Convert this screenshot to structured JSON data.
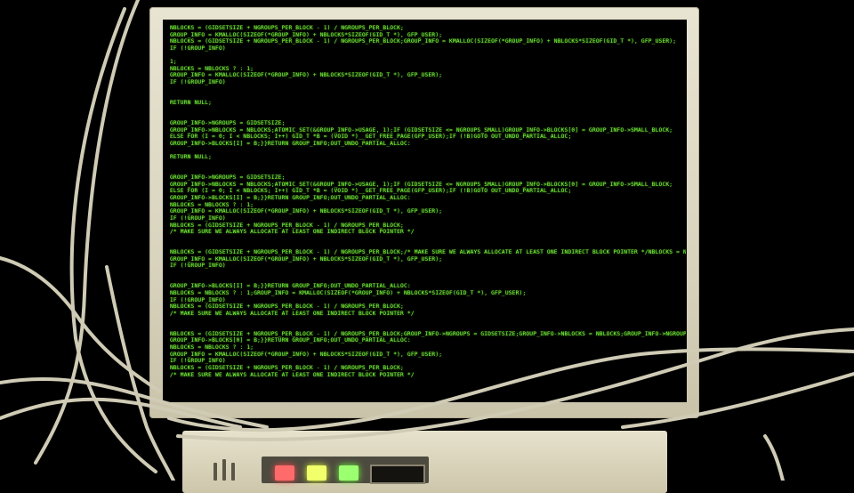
{
  "scene": {
    "description_free": true,
    "colors": {
      "background": "#000000",
      "bezel": "#e0dcc7",
      "terminal_text": "#7cff3a",
      "cable": "#cfcbb5",
      "led_red": "#ff6a6a",
      "led_yellow": "#f1ff6a",
      "led_green": "#9bff70"
    }
  },
  "terminal": {
    "lines": [
      "NBLOCKS = (GIDSETSIZE + NGROUPS_PER_BLOCK - 1) / NGROUPS_PER_BLOCK;",
      "GROUP_INFO = KMALLOC(SIZEOF(*GROUP_INFO) + NBLOCKS*SIZEOF(GID_T *), GFP_USER);",
      "NBLOCKS = (GIDSETSIZE + NGROUPS_PER_BLOCK - 1) / NGROUPS_PER_BLOCK;GROUP_INFO = KMALLOC(SIZEOF(*GROUP_INFO) + NBLOCKS*SIZEOF(GID_T *), GFP_USER);",
      "IF (!GROUP_INFO)",
      "",
      "1;",
      "NBLOCKS = NBLOCKS ? : 1;",
      "GROUP_INFO = KMALLOC(SIZEOF(*GROUP_INFO) + NBLOCKS*SIZEOF(GID_T *), GFP_USER);",
      "IF (!GROUP_INFO)",
      "",
      "",
      "RETURN NULL;",
      "",
      "",
      "GROUP_INFO->NGROUPS = GIDSETSIZE;",
      "GROUP_INFO->NBLOCKS = NBLOCKS;ATOMIC_SET(&GROUP_INFO->USAGE, 1);IF (GIDSETSIZE <= NGROUPS_SMALL)GROUP_INFO->BLOCKS[0] = GROUP_INFO->SMALL_BLOCK;",
      "ELSE FOR (I = 0; I < NBLOCKS; I++) GID_T *B = (VOID *)__GET_FREE_PAGE(GFP_USER);IF (!B)GOTO OUT_UNDO_PARTIAL_ALLOC;",
      "GROUP_INFO->BLOCKS[I] = B;}}RETURN GROUP_INFO;OUT_UNDO_PARTIAL_ALLOC:",
      "",
      "RETURN NULL;",
      "",
      "",
      "GROUP_INFO->NGROUPS = GIDSETSIZE;",
      "GROUP_INFO->NBLOCKS = NBLOCKS;ATOMIC_SET(&GROUP_INFO->USAGE, 1);IF (GIDSETSIZE <= NGROUPS_SMALL)GROUP_INFO->BLOCKS[0] = GROUP_INFO->SMALL_BLOCK;",
      "ELSE FOR (I = 0; I < NBLOCKS; I++) GID_T *B = (VOID *)__GET_FREE_PAGE(GFP_USER);IF (!B)GOTO OUT_UNDO_PARTIAL_ALLOC;",
      "GROUP_INFO->BLOCKS[I] = B;}}RETURN GROUP_INFO;OUT_UNDO_PARTIAL_ALLOC:",
      "NBLOCKS = NBLOCKS ? : 1;",
      "GROUP_INFO = KMALLOC(SIZEOF(*GROUP_INFO) + NBLOCKS*SIZEOF(GID_T *), GFP_USER);",
      "IF (!GROUP_INFO)",
      "NBLOCKS = (GIDSETSIZE + NGROUPS_PER_BLOCK - 1) / NGROUPS_PER_BLOCK;",
      "/* MAKE SURE WE ALWAYS ALLOCATE AT LEAST ONE INDIRECT BLOCK POINTER */",
      "",
      "",
      "NBLOCKS = (GIDSETSIZE + NGROUPS_PER_BLOCK - 1) / NGROUPS_PER_BLOCK;/* MAKE SURE WE ALWAYS ALLOCATE AT LEAST ONE INDIRECT BLOCK POINTER */NBLOCKS = NBLOCKS ? : 1;",
      "GROUP_INFO = KMALLOC(SIZEOF(*GROUP_INFO) + NBLOCKS*SIZEOF(GID_T *), GFP_USER);",
      "IF (!GROUP_INFO)",
      "",
      "",
      "GROUP_INFO->BLOCKS[I] = B;}}RETURN GROUP_INFO;OUT_UNDO_PARTIAL_ALLOC:",
      "NBLOCKS = NBLOCKS ? : 1;GROUP_INFO = KMALLOC(SIZEOF(*GROUP_INFO) + NBLOCKS*SIZEOF(GID_T *), GFP_USER);",
      "IF (!GROUP_INFO)",
      "NBLOCKS = (GIDSETSIZE + NGROUPS_PER_BLOCK - 1) / NGROUPS_PER_BLOCK;",
      "/* MAKE SURE WE ALWAYS ALLOCATE AT LEAST ONE INDIRECT BLOCK POINTER */",
      "",
      "",
      "NBLOCKS = (GIDSETSIZE + NGROUPS_PER_BLOCK - 1) / NGROUPS_PER_BLOCK;GROUP_INFO->NGROUPS = GIDSETSIZE;GROUP_INFO->NBLOCKS = NBLOCKS;GROUP_INFO->NGROUPS = GIDSETSIZE;",
      "GROUP_INFO->BLOCKS[0] = B;}}RETURN GROUP_INFO;OUT_UNDO_PARTIAL_ALLOC:",
      "NBLOCKS = NBLOCKS ? : 1;",
      "GROUP_INFO = KMALLOC(SIZEOF(*GROUP_INFO) + NBLOCKS*SIZEOF(GID_T *), GFP_USER);",
      "IF (!GROUP_INFO)",
      "NBLOCKS = (GIDSETSIZE + NGROUPS_PER_BLOCK - 1) / NGROUPS_PER_BLOCK;",
      "/* MAKE SURE WE ALWAYS ALLOCATE AT LEAST ONE INDIRECT BLOCK POINTER */"
    ]
  }
}
